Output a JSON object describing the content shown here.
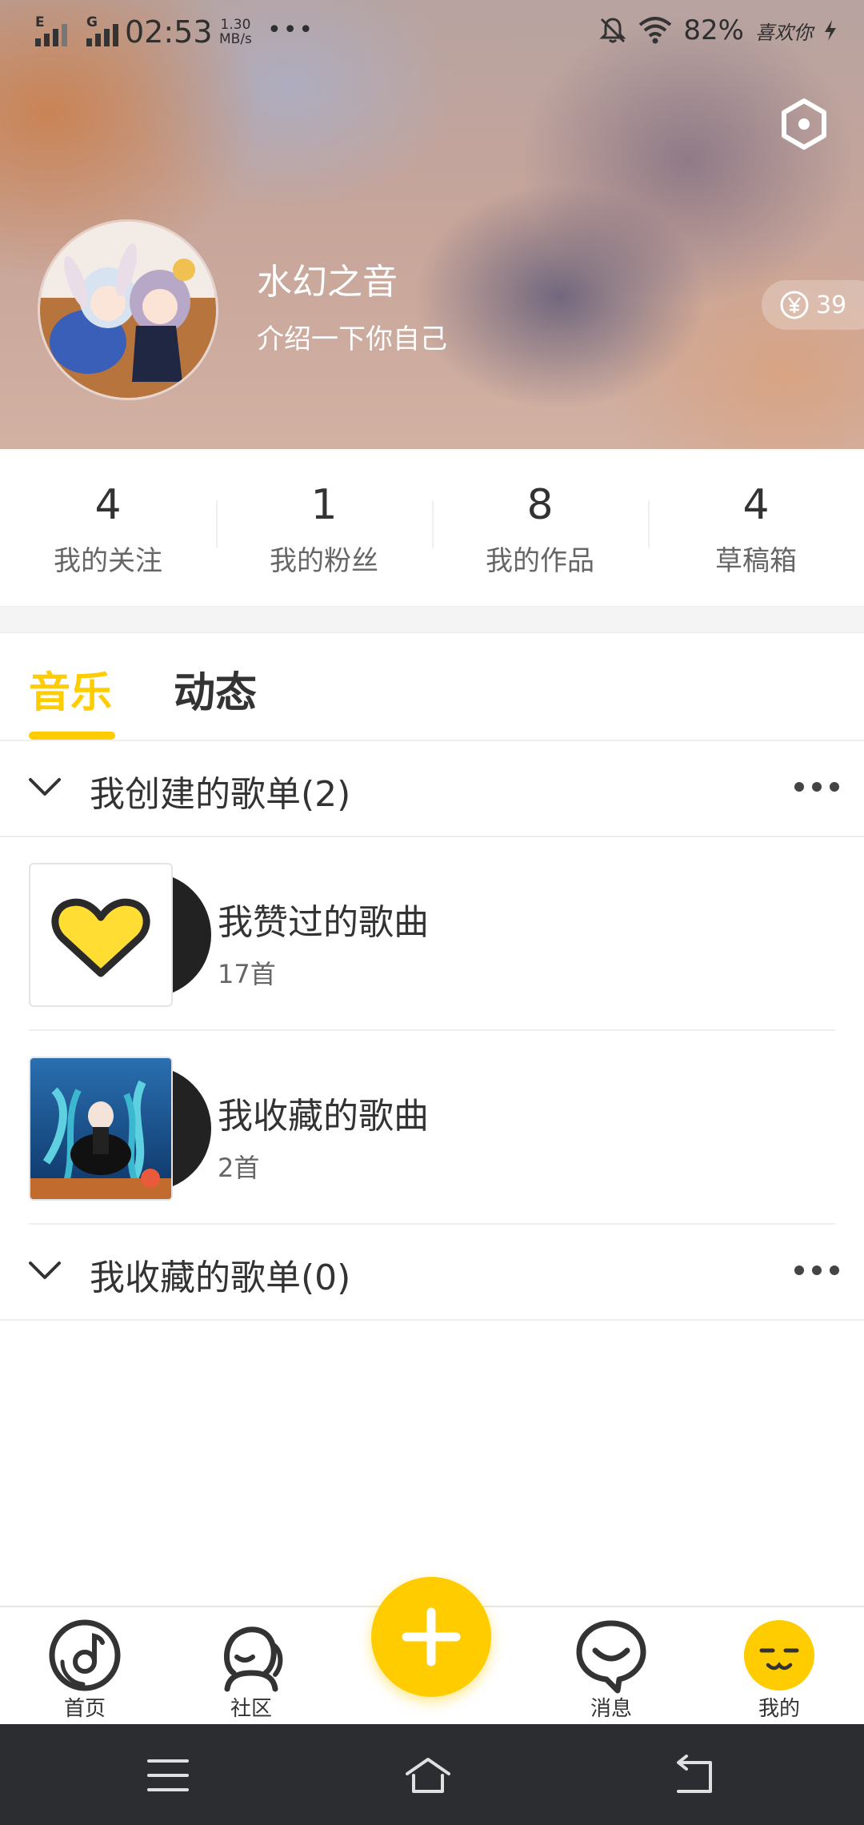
{
  "status_bar": {
    "net1": "E",
    "net2": "G",
    "time": "02:53",
    "speed_value": "1.30",
    "speed_unit": "MB/s",
    "battery": "82%",
    "carrier": "喜欢你"
  },
  "profile": {
    "name": "水幻之音",
    "bio": "介绍一下你自己",
    "coins": "39"
  },
  "stats": [
    {
      "value": "4",
      "label": "我的关注"
    },
    {
      "value": "1",
      "label": "我的粉丝"
    },
    {
      "value": "8",
      "label": "我的作品"
    },
    {
      "value": "4",
      "label": "草稿箱"
    }
  ],
  "tabs": [
    {
      "label": "音乐",
      "active": true
    },
    {
      "label": "动态",
      "active": false
    }
  ],
  "sections": {
    "created": {
      "title": "我创建的歌单(2)"
    },
    "collected": {
      "title": "我收藏的歌单(0)"
    }
  },
  "playlists": [
    {
      "title": "我赞过的歌曲",
      "count": "17首",
      "icon": "heart-icon"
    },
    {
      "title": "我收藏的歌曲",
      "count": "2首",
      "icon": "anime-cover"
    }
  ],
  "bottom_nav": [
    {
      "label": "首页",
      "icon": "music-disc-icon"
    },
    {
      "label": "社区",
      "icon": "community-icon"
    },
    {
      "label": "",
      "icon": "plus-icon"
    },
    {
      "label": "消息",
      "icon": "message-icon"
    },
    {
      "label": "我的",
      "icon": "profile-face-icon"
    }
  ],
  "colors": {
    "accent": "#ffcc00",
    "text": "#333333",
    "system_nav": "#2b2d31"
  }
}
